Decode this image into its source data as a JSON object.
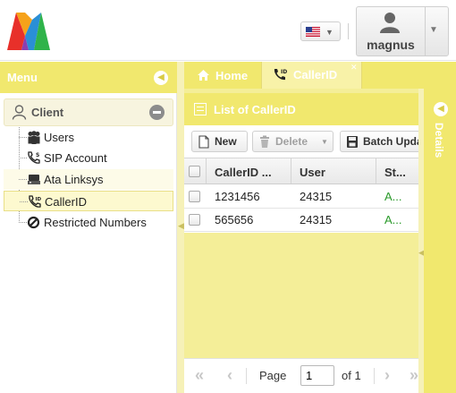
{
  "header": {
    "language_flag": "us-flag-icon",
    "user": {
      "name": "magnus",
      "icon": "user-icon"
    }
  },
  "menu": {
    "title": "Menu",
    "group": {
      "label": "Client",
      "icon": "person-icon"
    },
    "items": [
      {
        "label": "Users",
        "icon": "users-icon"
      },
      {
        "label": "SIP Account",
        "icon": "sip-phone-icon"
      },
      {
        "label": "Ata Linksys",
        "icon": "device-icon"
      },
      {
        "label": "CallerID",
        "icon": "callerid-icon"
      },
      {
        "label": "Restricted Numbers",
        "icon": "restricted-icon"
      }
    ]
  },
  "tabs": [
    {
      "label": "Home",
      "icon": "home-icon"
    },
    {
      "label": "CallerID",
      "icon": "callerid-icon",
      "active": true
    }
  ],
  "panel": {
    "title": "List of CallerID",
    "toolbar": {
      "new_label": "New",
      "delete_label": "Delete",
      "batch_label": "Batch Update"
    },
    "grid": {
      "columns": [
        "CallerID ...",
        "User",
        "St..."
      ],
      "rows": [
        {
          "callerid": "1231456",
          "user": "24315",
          "status": "A..."
        },
        {
          "callerid": "565656",
          "user": "24315",
          "status": "A..."
        }
      ]
    },
    "pager": {
      "page_label": "Page",
      "page_value": "1",
      "of_label": "of 1"
    }
  },
  "details": {
    "label": "Details"
  },
  "colors": {
    "accent_yellow": "#f1e86e",
    "status_green": "#2a9a2a"
  }
}
